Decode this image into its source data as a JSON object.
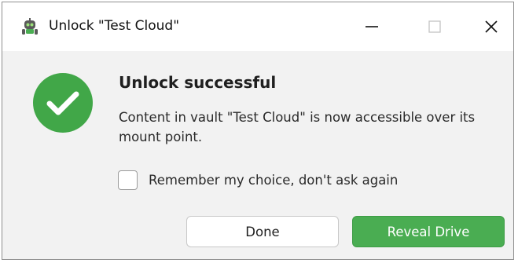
{
  "window": {
    "title": "Unlock \"Test Cloud\"",
    "app_icon": "cryptomator-robot-icon"
  },
  "controls": {
    "minimize_icon": "minimize-icon",
    "maximize_icon": "maximize-icon",
    "close_icon": "close-icon"
  },
  "status": {
    "icon": "check-circle-icon",
    "headline": "Unlock successful",
    "message": "Content in vault \"Test Cloud\" is now accessible over its mount point."
  },
  "remember": {
    "label": "Remember my choice, don't ask again",
    "checked": false
  },
  "buttons": {
    "done": "Done",
    "reveal": "Reveal Drive"
  },
  "colors": {
    "accent_green": "#4aad52",
    "success_green": "#41a748",
    "window_bg": "#f2f2f2",
    "titlebar_bg": "#ffffff"
  }
}
